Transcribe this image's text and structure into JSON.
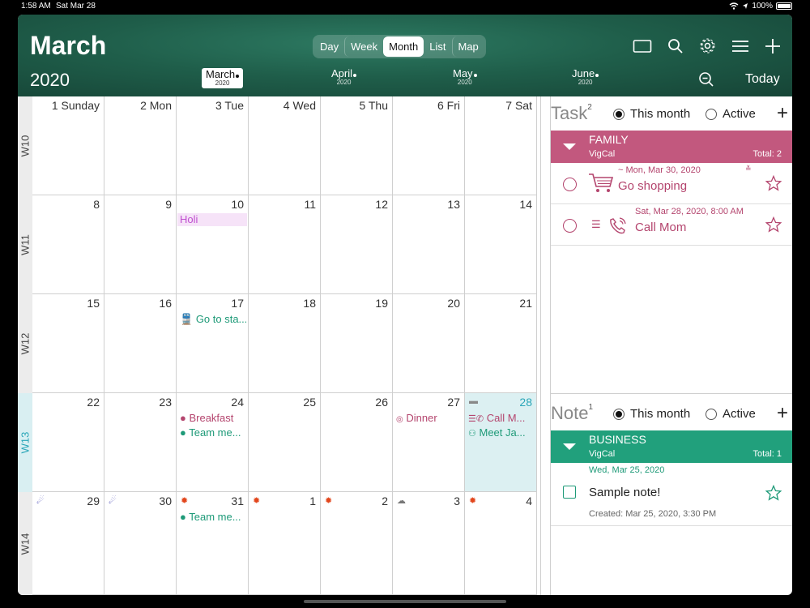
{
  "status": {
    "time": "1:58 AM",
    "date": "Sat Mar 28",
    "battery": "100%"
  },
  "header": {
    "month": "March",
    "year": "2020",
    "views": [
      "Day",
      "Week",
      "Month",
      "List",
      "Map"
    ],
    "active_view": "Month",
    "months": [
      {
        "name": "March",
        "year": "2020",
        "current": true
      },
      {
        "name": "April",
        "year": "2020",
        "current": false
      },
      {
        "name": "May",
        "year": "2020",
        "current": false
      },
      {
        "name": "June",
        "year": "2020",
        "current": false
      }
    ],
    "today_label": "Today",
    "icons": [
      "rectangle-icon",
      "search-icon",
      "gear-icon",
      "menu-icon",
      "plus-icon"
    ]
  },
  "calendar": {
    "day_headers": [
      "1 Sunday",
      "2 Mon",
      "3 Tue",
      "4 Wed",
      "5 Thu",
      "6 Fri",
      "7 Sat"
    ],
    "weeks": [
      {
        "label": "W10",
        "days": [
          "",
          "",
          "",
          "",
          "",
          "",
          ""
        ]
      },
      {
        "label": "W11",
        "days": [
          "8",
          "9",
          "10",
          "11",
          "12",
          "13",
          "14"
        ]
      },
      {
        "label": "W12",
        "days": [
          "15",
          "16",
          "17",
          "18",
          "19",
          "20",
          "21"
        ]
      },
      {
        "label": "W13",
        "days": [
          "22",
          "23",
          "24",
          "25",
          "26",
          "27",
          "28"
        ]
      },
      {
        "label": "W14",
        "days": [
          "29",
          "30",
          "31",
          "1",
          "2",
          "3",
          "4"
        ]
      }
    ],
    "events": {
      "holi": "Holi",
      "go_station": "Go to sta...",
      "breakfast": "Breakfast",
      "team_meeting_24": "Team me...",
      "dinner": "Dinner",
      "call_mom": "Call M...",
      "meet_ja": "Meet Ja...",
      "team_meeting_31": "Team me..."
    }
  },
  "tasks": {
    "title": "Task",
    "count": "2",
    "filter_this_month": "This month",
    "filter_active": "Active",
    "group": {
      "name": "FAMILY",
      "source": "VigCal",
      "total": "Total:  2",
      "color": "#c2587e"
    },
    "items": [
      {
        "when": "~ Mon, Mar 30, 2020",
        "title": "Go shopping"
      },
      {
        "when": "Sat, Mar 28, 2020, 8:00 AM",
        "title": "Call Mom"
      }
    ]
  },
  "notes": {
    "title": "Note",
    "count": "1",
    "filter_this_month": "This month",
    "filter_active": "Active",
    "group": {
      "name": "BUSINESS",
      "source": "VigCal",
      "total": "Total:  1",
      "color": "#21a07c"
    },
    "date": "Wed, Mar 25, 2020",
    "item": {
      "title": "Sample note!",
      "created": "Created: Mar 25, 2020, 3:30 PM"
    }
  }
}
